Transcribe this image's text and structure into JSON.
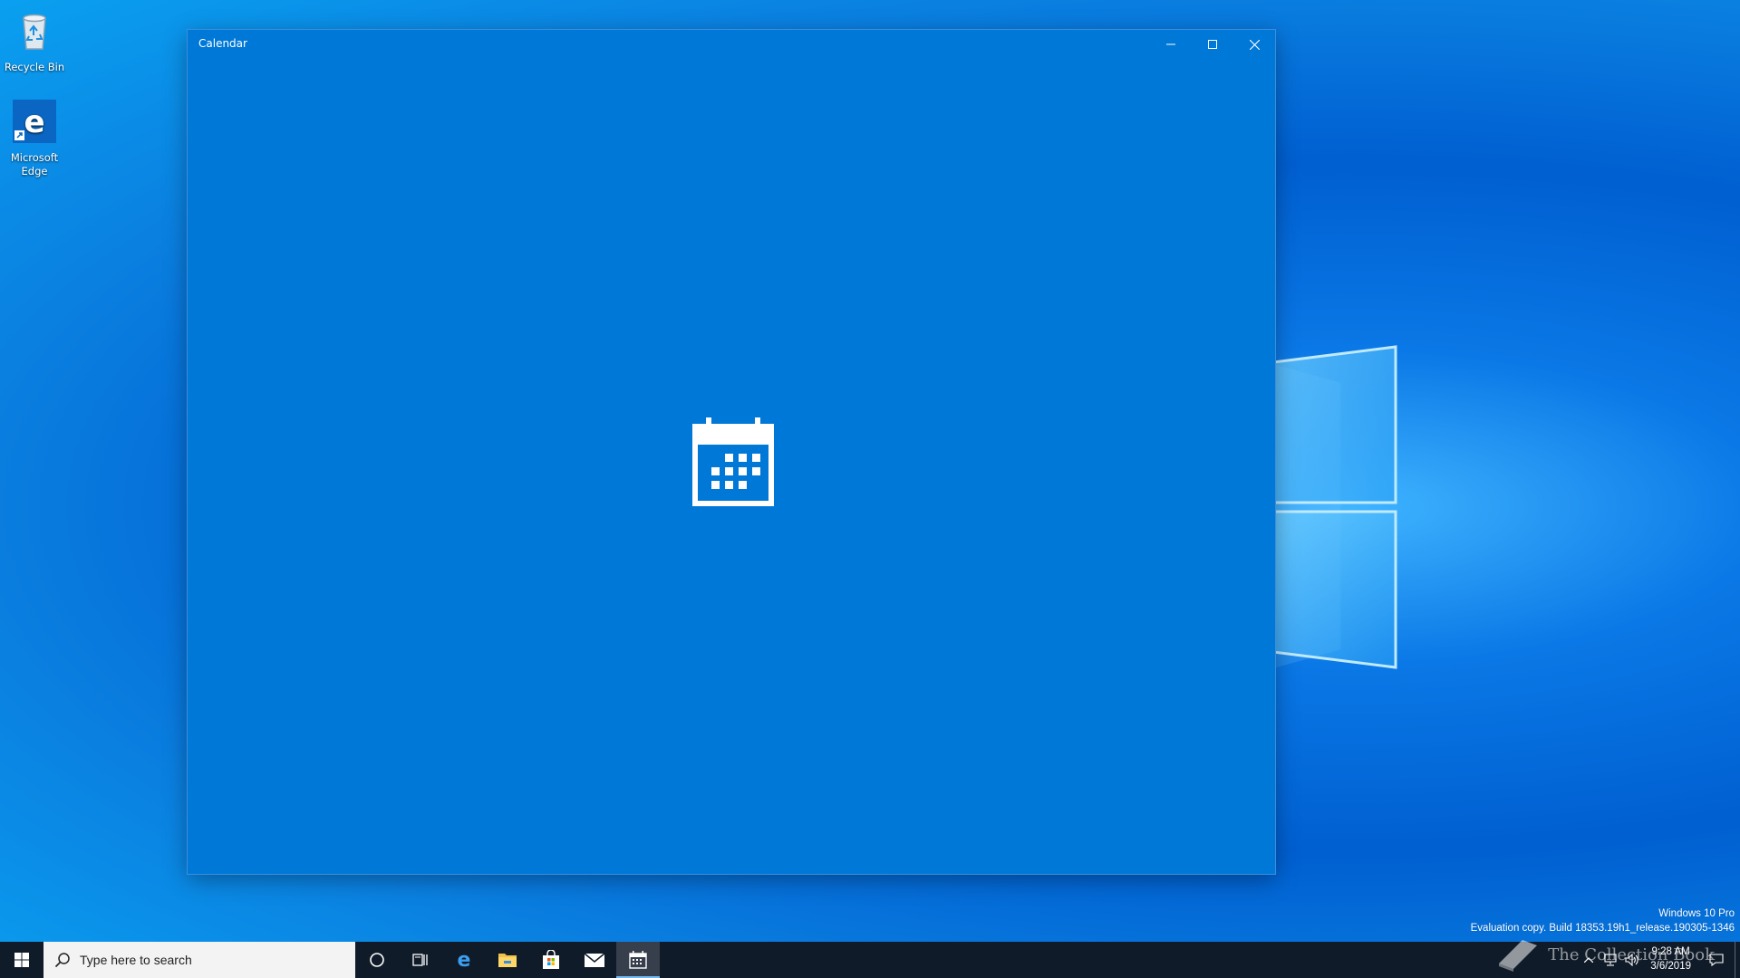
{
  "desktop": {
    "icons": [
      {
        "label": "Recycle Bin",
        "icon": "recycle-bin-icon"
      },
      {
        "label": "Microsoft Edge",
        "icon": "edge-icon"
      }
    ],
    "watermark": {
      "edition": "Windows 10 Pro",
      "build": "Evaluation copy. Build 18353.19h1_release.190305-1346"
    },
    "overlay_logo_text": "The Collection Book"
  },
  "window": {
    "title": "Calendar",
    "splash_icon": "calendar-icon",
    "background": "#0078d7",
    "controls": {
      "minimize": "minimize-icon",
      "maximize": "maximize-icon",
      "close": "close-icon"
    }
  },
  "taskbar": {
    "start_icon": "windows-start-icon",
    "search_placeholder": "Type here to search",
    "pinned": [
      {
        "name": "Cortana",
        "icon": "cortana-icon"
      },
      {
        "name": "Task View",
        "icon": "task-view-icon"
      },
      {
        "name": "Microsoft Edge",
        "icon": "edge-icon"
      },
      {
        "name": "File Explorer",
        "icon": "folder-icon"
      },
      {
        "name": "Microsoft Store",
        "icon": "store-icon"
      },
      {
        "name": "Mail",
        "icon": "mail-icon"
      },
      {
        "name": "Calendar",
        "icon": "calendar-icon",
        "active": true
      }
    ],
    "tray": {
      "time": "9:28 AM",
      "date": "3/6/2019",
      "icons": [
        "chevron-up-icon",
        "network-icon",
        "volume-icon"
      ],
      "notification_icon": "action-center-icon"
    },
    "background": "#101b29"
  }
}
